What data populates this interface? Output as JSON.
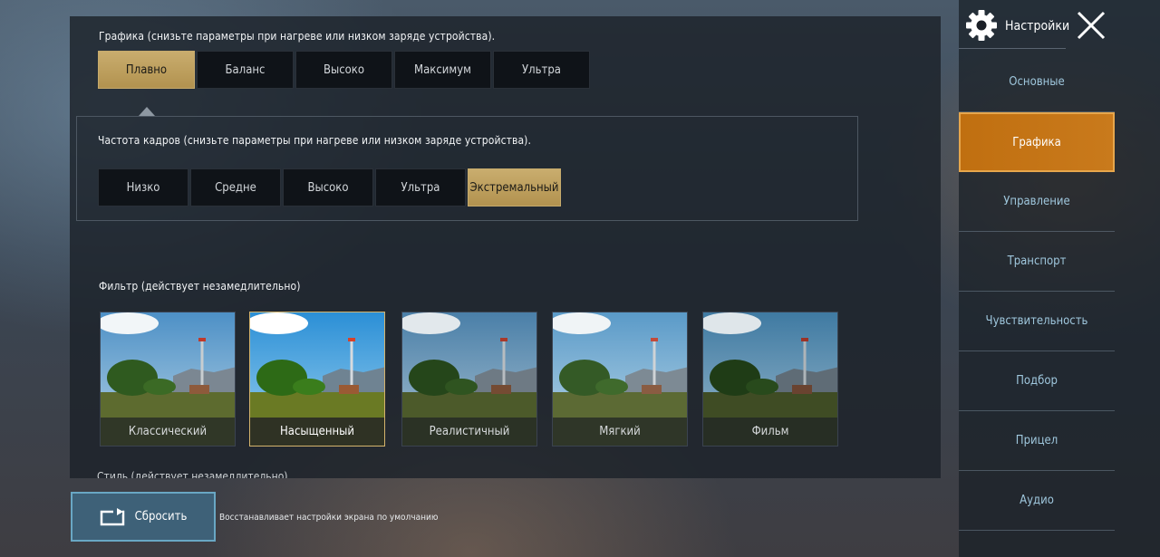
{
  "graphics": {
    "label": "Графика (снизьте параметры при нагреве или низком заряде устройства).",
    "options": [
      "Плавно",
      "Баланс",
      "Высоко",
      "Максимум",
      "Ультра"
    ],
    "selected_index": 0
  },
  "fps": {
    "label": "Частота кадров (снизьте параметры при нагреве или низком заряде устройства).",
    "options": [
      "Низко",
      "Средне",
      "Высоко",
      "Ультра",
      "Экстремальный"
    ],
    "selected_index": 4
  },
  "filter": {
    "label": "Фильтр (действует незамедлительно)",
    "items": [
      {
        "label": "Классический"
      },
      {
        "label": "Насыщенный"
      },
      {
        "label": "Реалистичный"
      },
      {
        "label": "Мягкий"
      },
      {
        "label": "Фильм"
      }
    ],
    "selected_index": 1
  },
  "next_section_partial": "Стиль (действует незамедлительно)",
  "reset": {
    "label": "Сбросить",
    "description": "Восстанавливает настройки экрана по умолчанию"
  },
  "sidebar": {
    "title": "Настройки",
    "items": [
      {
        "label": "Основные"
      },
      {
        "label": "Графика"
      },
      {
        "label": "Управление"
      },
      {
        "label": "Транспорт"
      },
      {
        "label": "Чувствительность"
      },
      {
        "label": "Подбор"
      },
      {
        "label": "Прицел"
      },
      {
        "label": "Аудио"
      }
    ],
    "selected_index": 1
  },
  "colors": {
    "accent_gold": "#c9ad6e",
    "accent_orange": "#c97a1c",
    "reset_blue": "#3e6178"
  },
  "icons": [
    "gear-icon",
    "close-icon",
    "reset-icon",
    "pointer-arrow-icon"
  ]
}
